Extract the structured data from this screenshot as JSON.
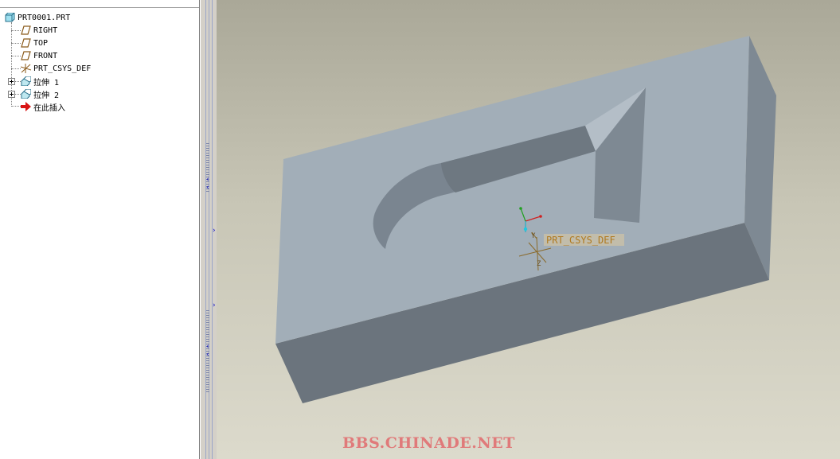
{
  "model_tree": {
    "items": [
      {
        "label": "PRT0001.PRT",
        "icon": "part-icon"
      },
      {
        "label": "RIGHT",
        "icon": "datum-plane-icon"
      },
      {
        "label": "TOP",
        "icon": "datum-plane-icon"
      },
      {
        "label": "FRONT",
        "icon": "datum-plane-icon"
      },
      {
        "label": "PRT_CSYS_DEF",
        "icon": "csys-icon"
      },
      {
        "label": "拉伸 1",
        "icon": "extrude-icon"
      },
      {
        "label": "拉伸 2",
        "icon": "extrude-icon"
      },
      {
        "label": "在此插入",
        "icon": "insert-here-arrow-icon"
      }
    ]
  },
  "viewport": {
    "csys_label": "PRT_CSYS_DEF",
    "axis_y": "Y",
    "axis_z": "Z",
    "watermark": "BBS.CHINADE.NET"
  },
  "colors": {
    "top_face": "#a2aeb8",
    "front_face": "#6b747d",
    "right_face": "#7e8993",
    "background_top": "#aaa898",
    "background_bottom": "#dcdacc",
    "watermark": "#e07a7a"
  }
}
